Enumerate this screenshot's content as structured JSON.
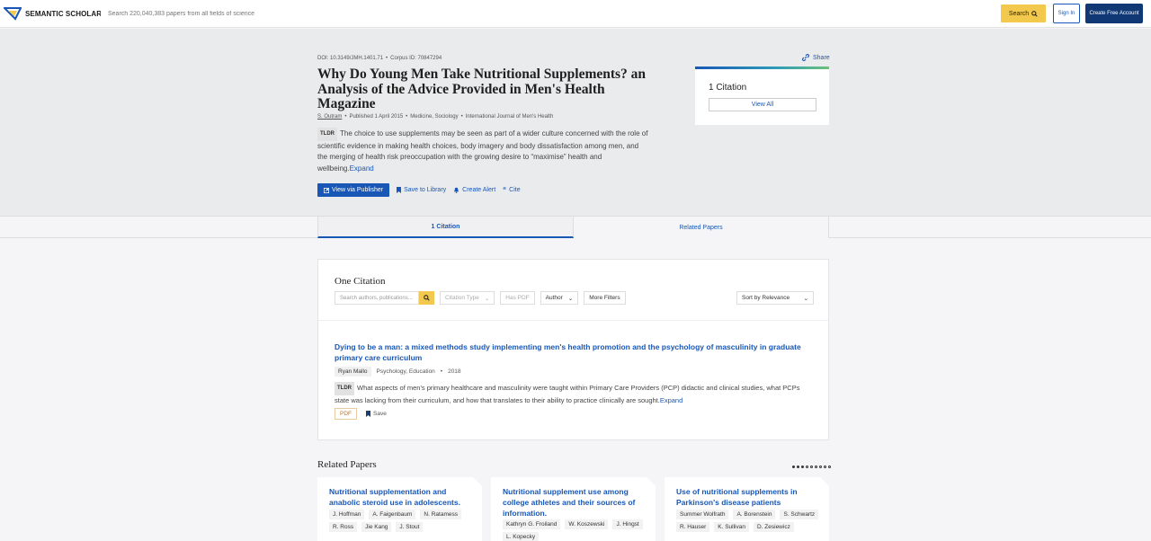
{
  "header": {
    "logo_text": "SEMANTIC SCHOLAR",
    "search_placeholder": "Search 220,040,383 papers from all fields of science",
    "search_button": "Search",
    "signin_button": "Sign In",
    "create_account_button": "Create Free Account"
  },
  "paper": {
    "doi": "DOI: 10.3149/JMH.1401.71",
    "corpus_id": "Corpus ID: 70847294",
    "title": "Why Do Young Men Take Nutritional Supplements? an Analysis of the Advice Provided in Men's Health Magazine",
    "author": "S. Outram",
    "published": "Published 1 April 2015",
    "fields": "Medicine, Sociology",
    "venue": "International Journal of Men's Health",
    "tldr_label": "TLDR",
    "tldr_text": "The choice to use supplements may be seen as part of a wider culture concerned with the role of scientific evidence in making health choices, body imagery and body dissatisfaction among men, and the merging of health risk preoccupation with the growing desire to “maximise” health and wellbeing.",
    "expand": "Expand",
    "actions": {
      "view_publisher": "View via Publisher",
      "save_library": "Save to Library",
      "create_alert": "Create Alert",
      "cite": "Cite"
    },
    "share": "Share",
    "citation_card": {
      "count": "1 Citation",
      "view_all": "View All"
    }
  },
  "tabs": [
    "1 Citation",
    "Related Papers"
  ],
  "citations": {
    "heading": "One Citation",
    "filter_placeholder": "Search authors, publications...",
    "filter_citation_type": "Citation Type",
    "filter_has_pdf": "Has PDF",
    "filter_author": "Author",
    "filter_more": "More Filters",
    "sort": "Sort by Relevance",
    "result": {
      "title": "Dying to be a man: a mixed methods study implementing men's health promotion and the psychology of masculinity in graduate primary care curriculum",
      "author": "Ryan Mallo",
      "fields": "Psychology, Education",
      "year": "2018",
      "tldr_label": "TLDR",
      "tldr_text": "What aspects of men's primary healthcare and masculinity were taught within Primary Care Providers (PCP) didactic and clinical studies, what PCPs state was lacking from their curriculum, and how that translates to their ability to practice clinically are sought.",
      "expand": "Expand",
      "pdf": "PDF",
      "save": "Save"
    }
  },
  "related": {
    "heading": "Related Papers",
    "papers": [
      {
        "title": "Nutritional supplementation and anabolic steroid use in adolescents.",
        "authors": [
          "J. Hoffman",
          "A. Faigenbaum",
          "N. Ratamess",
          "R. Ross",
          "Jie Kang",
          "J. Stout"
        ]
      },
      {
        "title": "Nutritional supplement use among college athletes and their sources of information.",
        "authors": [
          "Kathryn G. Froiland",
          "W. Koszewski",
          "J. Hingst",
          "L. Kopecky"
        ]
      },
      {
        "title": "Use of nutritional supplements in Parkinson's disease patients",
        "authors": [
          "Summer Wolfrath",
          "A. Borenstein",
          "S. Schwartz",
          "R. Hauser",
          "K. Sullivan",
          "D. Zesiewicz"
        ]
      }
    ]
  },
  "colors": {
    "accent_blue": "#1857b6",
    "navy": "#0f3875",
    "yellow": "#f2c94c"
  }
}
